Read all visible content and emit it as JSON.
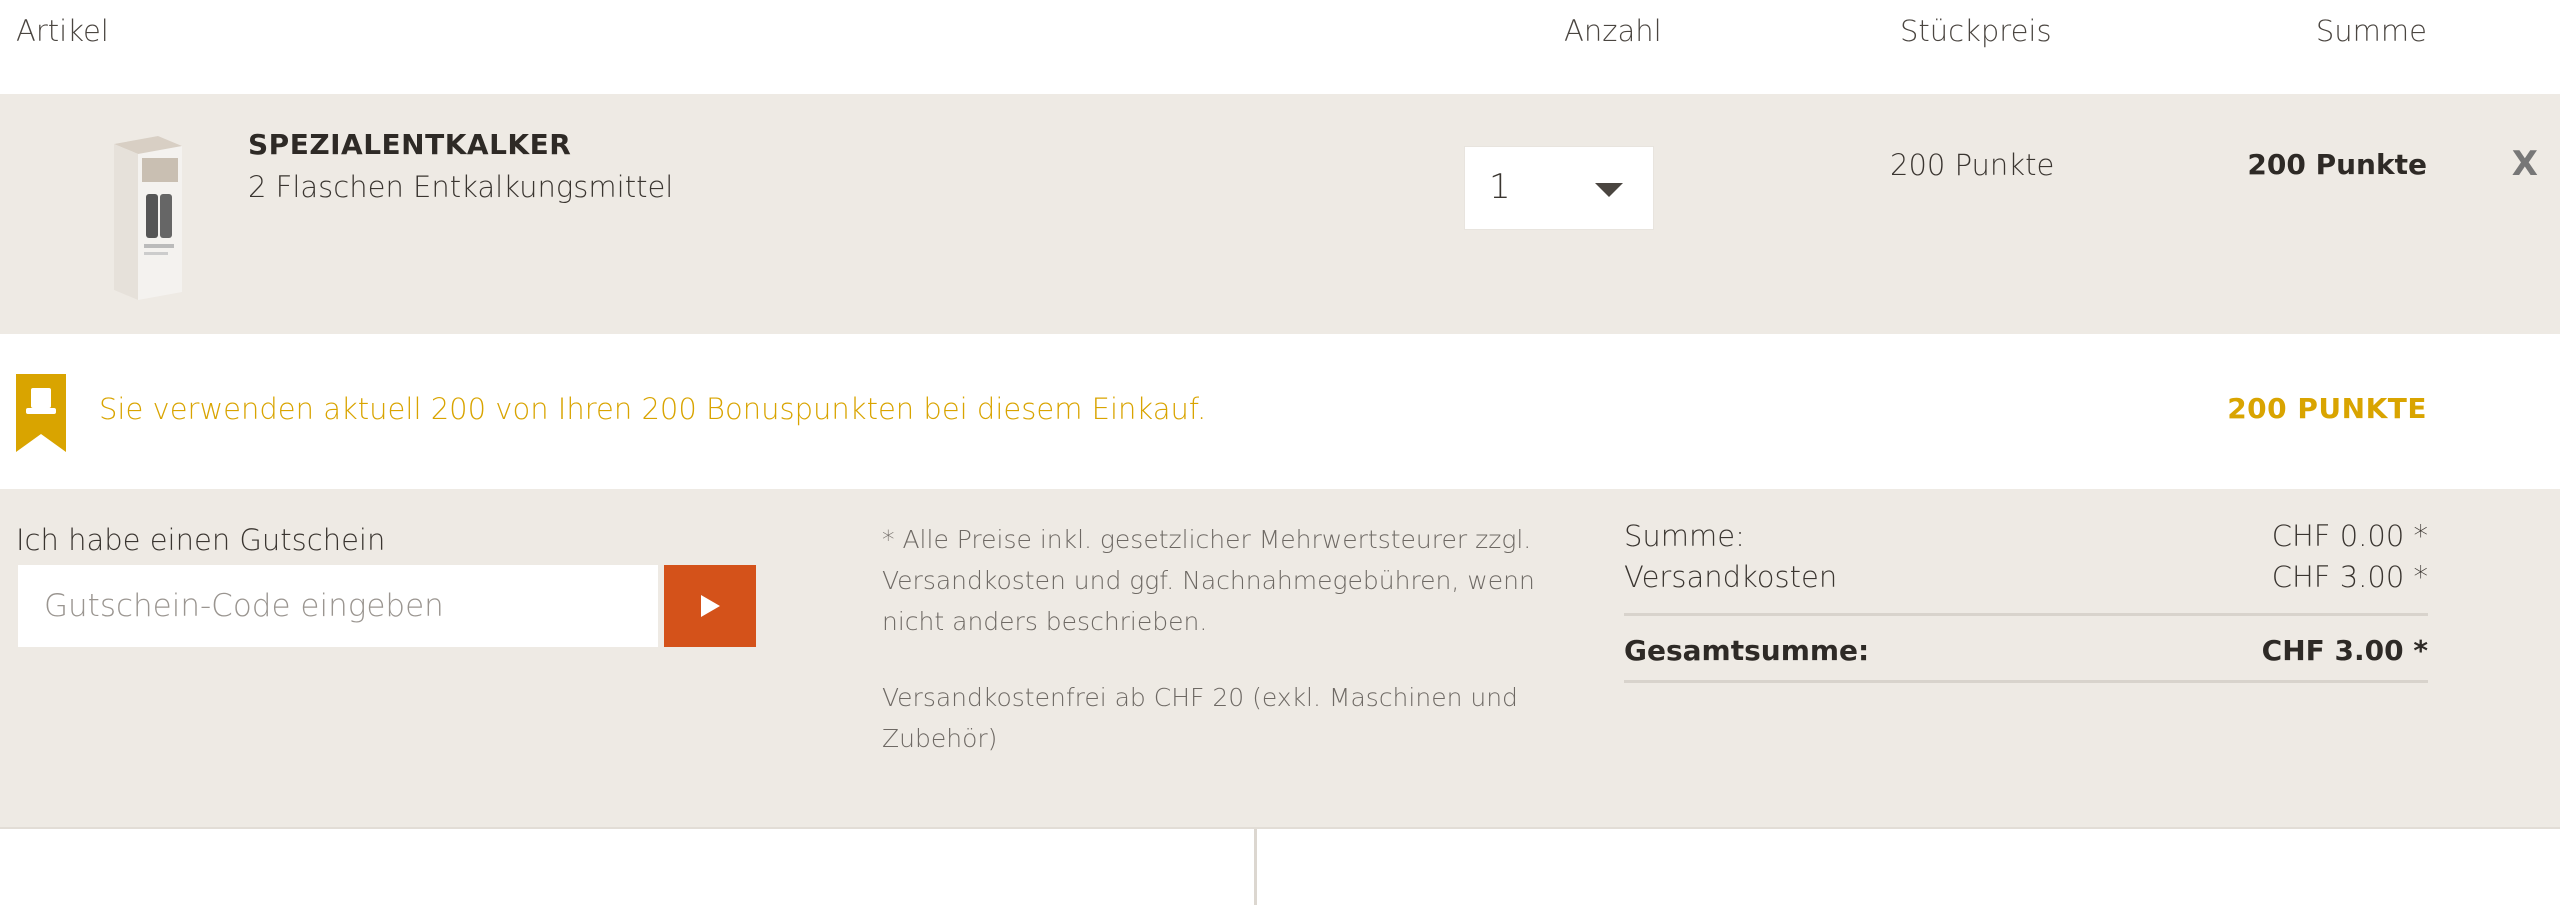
{
  "header": {
    "artikel": "Artikel",
    "anzahl": "Anzahl",
    "stueckpreis": "Stückpreis",
    "summe": "Summe"
  },
  "product": {
    "name": "SPEZIALENTKALKER",
    "description": "2 Flaschen Entkalkungsmittel",
    "quantity": "1",
    "unit_price": "200 Punkte",
    "row_sum": "200 Punkte",
    "remove_label": "X",
    "image_icon": "product-box-image"
  },
  "bonus": {
    "text": "Sie verwenden aktuell 200 von Ihren 200 Bonuspunkten bei diesem Einkauf.",
    "points": "200 PUNKTE",
    "color": "#d9a400",
    "icon": "bonus-bookmark-icon"
  },
  "voucher": {
    "label": "Ich habe einen Gutschein",
    "placeholder": "Gutschein-Code eingeben",
    "submit_icon": "play-icon",
    "submit_color": "#d4521a"
  },
  "notes": {
    "vat": "* Alle Preise inkl. gesetzlicher Mehrwertsteurer zzgl. Versandkosten und ggf. Nachnahmegebühren, wenn nicht anders beschrieben.",
    "shipping": "Versandkostenfrei ab CHF 20 (exkl. Maschinen und Zubehör)"
  },
  "totals": {
    "summe_label": "Summe:",
    "summe_value": "CHF 0.00 *",
    "versand_label": "Versandkosten",
    "versand_value": "CHF 3.00 *",
    "gesamt_label": "Gesamtsumme:",
    "gesamt_value": "CHF 3.00 *"
  }
}
